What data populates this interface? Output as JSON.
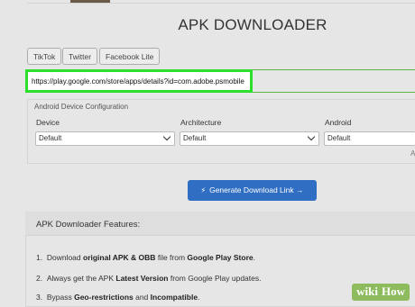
{
  "page": {
    "title": "APK DOWNLOADER"
  },
  "quick_links": [
    {
      "label": "TikTok"
    },
    {
      "label": "Twitter"
    },
    {
      "label": "Facebook Lite"
    }
  ],
  "url_input": {
    "value": "https://play.google.com/store/apps/details?id=com.adobe.psmobile"
  },
  "config": {
    "title": "Android Device Configuration",
    "fields": [
      {
        "label": "Device",
        "selected": "Default"
      },
      {
        "label": "Architecture",
        "selected": "Default"
      },
      {
        "label": "Android",
        "selected": "Default"
      }
    ],
    "edge_glyph": "A"
  },
  "generate_button": {
    "icon": "bolt-icon",
    "label": "Generate Download Link →"
  },
  "features": {
    "title": "APK Downloader Features:",
    "items": [
      {
        "n": "1.",
        "pre": "Download ",
        "b1": "original APK & OBB",
        "mid": " file from ",
        "b2": "Google Play Store",
        "post": "."
      },
      {
        "n": "2.",
        "pre": "Always get the APK ",
        "b1": "Latest Version",
        "mid": " from Google Play updates.",
        "b2": "",
        "post": ""
      },
      {
        "n": "3.",
        "pre": "Bypass ",
        "b1": "Geo-restrictions",
        "mid": " and ",
        "b2": "Incompatible",
        "post": "."
      }
    ]
  },
  "watermark": {
    "part1": "wiki",
    "part2": "How"
  }
}
